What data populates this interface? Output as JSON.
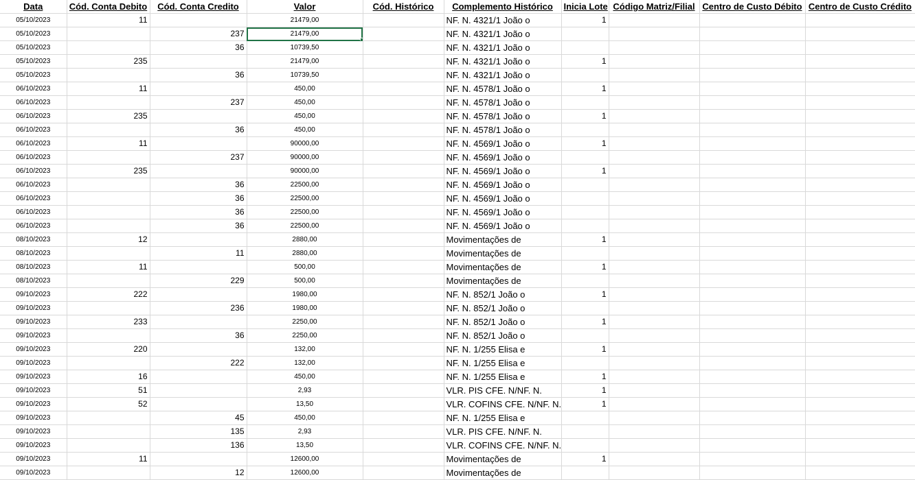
{
  "headers": [
    "Data",
    "Cód. Conta Debito",
    "Cód. Conta Credito",
    "Valor",
    "Cód. Histórico",
    "Complemento Histórico",
    "Inicia Lote",
    "Código Matriz/Filial",
    "Centro de Custo Débito",
    "Centro de Custo Crédito"
  ],
  "rows": [
    {
      "data": "05/10/2023",
      "deb": "11",
      "cred": "",
      "valor": "21479,00",
      "hist": "",
      "comp": "NF. N. 4321/1 João o",
      "lote": "1"
    },
    {
      "data": "05/10/2023",
      "deb": "",
      "cred": "237",
      "valor": "21479,00",
      "hist": "",
      "comp": "NF. N. 4321/1 João o",
      "lote": ""
    },
    {
      "data": "05/10/2023",
      "deb": "",
      "cred": "36",
      "valor": "10739,50",
      "hist": "",
      "comp": "NF. N. 4321/1 João o",
      "lote": ""
    },
    {
      "data": "05/10/2023",
      "deb": "235",
      "cred": "",
      "valor": "21479,00",
      "hist": "",
      "comp": "NF. N. 4321/1 João o",
      "lote": "1"
    },
    {
      "data": "05/10/2023",
      "deb": "",
      "cred": "36",
      "valor": "10739,50",
      "hist": "",
      "comp": "NF. N. 4321/1 João o",
      "lote": ""
    },
    {
      "data": "06/10/2023",
      "deb": "11",
      "cred": "",
      "valor": "450,00",
      "hist": "",
      "comp": "NF. N. 4578/1 João o",
      "lote": "1"
    },
    {
      "data": "06/10/2023",
      "deb": "",
      "cred": "237",
      "valor": "450,00",
      "hist": "",
      "comp": "NF. N. 4578/1 João o",
      "lote": ""
    },
    {
      "data": "06/10/2023",
      "deb": "235",
      "cred": "",
      "valor": "450,00",
      "hist": "",
      "comp": "NF. N. 4578/1 João o",
      "lote": "1"
    },
    {
      "data": "06/10/2023",
      "deb": "",
      "cred": "36",
      "valor": "450,00",
      "hist": "",
      "comp": "NF. N. 4578/1 João o",
      "lote": ""
    },
    {
      "data": "06/10/2023",
      "deb": "11",
      "cred": "",
      "valor": "90000,00",
      "hist": "",
      "comp": "NF. N. 4569/1 João o",
      "lote": "1"
    },
    {
      "data": "06/10/2023",
      "deb": "",
      "cred": "237",
      "valor": "90000,00",
      "hist": "",
      "comp": "NF. N. 4569/1 João o",
      "lote": ""
    },
    {
      "data": "06/10/2023",
      "deb": "235",
      "cred": "",
      "valor": "90000,00",
      "hist": "",
      "comp": "NF. N. 4569/1 João o",
      "lote": "1"
    },
    {
      "data": "06/10/2023",
      "deb": "",
      "cred": "36",
      "valor": "22500,00",
      "hist": "",
      "comp": "NF. N. 4569/1 João o",
      "lote": ""
    },
    {
      "data": "06/10/2023",
      "deb": "",
      "cred": "36",
      "valor": "22500,00",
      "hist": "",
      "comp": "NF. N. 4569/1 João o",
      "lote": ""
    },
    {
      "data": "06/10/2023",
      "deb": "",
      "cred": "36",
      "valor": "22500,00",
      "hist": "",
      "comp": "NF. N. 4569/1 João o",
      "lote": ""
    },
    {
      "data": "06/10/2023",
      "deb": "",
      "cred": "36",
      "valor": "22500,00",
      "hist": "",
      "comp": "NF. N. 4569/1 João o",
      "lote": ""
    },
    {
      "data": "08/10/2023",
      "deb": "12",
      "cred": "",
      "valor": "2880,00",
      "hist": "",
      "comp": "Movimentações de",
      "lote": "1"
    },
    {
      "data": "08/10/2023",
      "deb": "",
      "cred": "11",
      "valor": "2880,00",
      "hist": "",
      "comp": "Movimentações de",
      "lote": ""
    },
    {
      "data": "08/10/2023",
      "deb": "11",
      "cred": "",
      "valor": "500,00",
      "hist": "",
      "comp": "Movimentações de",
      "lote": "1"
    },
    {
      "data": "08/10/2023",
      "deb": "",
      "cred": "229",
      "valor": "500,00",
      "hist": "",
      "comp": "Movimentações de",
      "lote": ""
    },
    {
      "data": "09/10/2023",
      "deb": "222",
      "cred": "",
      "valor": "1980,00",
      "hist": "",
      "comp": "NF. N. 852/1 João o",
      "lote": "1"
    },
    {
      "data": "09/10/2023",
      "deb": "",
      "cred": "236",
      "valor": "1980,00",
      "hist": "",
      "comp": "NF. N. 852/1 João o",
      "lote": ""
    },
    {
      "data": "09/10/2023",
      "deb": "233",
      "cred": "",
      "valor": "2250,00",
      "hist": "",
      "comp": "NF. N. 852/1 João o",
      "lote": "1"
    },
    {
      "data": "09/10/2023",
      "deb": "",
      "cred": "36",
      "valor": "2250,00",
      "hist": "",
      "comp": "NF. N. 852/1 João o",
      "lote": ""
    },
    {
      "data": "09/10/2023",
      "deb": "220",
      "cred": "",
      "valor": "132,00",
      "hist": "",
      "comp": "NF. N. 1/255 Elisa e",
      "lote": "1"
    },
    {
      "data": "09/10/2023",
      "deb": "",
      "cred": "222",
      "valor": "132,00",
      "hist": "",
      "comp": "NF. N. 1/255 Elisa e",
      "lote": ""
    },
    {
      "data": "09/10/2023",
      "deb": "16",
      "cred": "",
      "valor": "450,00",
      "hist": "",
      "comp": "NF. N. 1/255 Elisa e",
      "lote": "1"
    },
    {
      "data": "09/10/2023",
      "deb": "51",
      "cred": "",
      "valor": "2,93",
      "hist": "",
      "comp": "VLR. PIS CFE. N/NF. N.",
      "lote": "1"
    },
    {
      "data": "09/10/2023",
      "deb": "52",
      "cred": "",
      "valor": "13,50",
      "hist": "",
      "comp": "VLR. COFINS CFE. N/NF. N.",
      "lote": "1"
    },
    {
      "data": "09/10/2023",
      "deb": "",
      "cred": "45",
      "valor": "450,00",
      "hist": "",
      "comp": "NF. N. 1/255 Elisa e",
      "lote": ""
    },
    {
      "data": "09/10/2023",
      "deb": "",
      "cred": "135",
      "valor": "2,93",
      "hist": "",
      "comp": "VLR. PIS CFE. N/NF. N.",
      "lote": ""
    },
    {
      "data": "09/10/2023",
      "deb": "",
      "cred": "136",
      "valor": "13,50",
      "hist": "",
      "comp": "VLR. COFINS CFE. N/NF. N.",
      "lote": ""
    },
    {
      "data": "09/10/2023",
      "deb": "11",
      "cred": "",
      "valor": "12600,00",
      "hist": "",
      "comp": "Movimentações de",
      "lote": "1"
    },
    {
      "data": "09/10/2023",
      "deb": "",
      "cred": "12",
      "valor": "12600,00",
      "hist": "",
      "comp": "Movimentações de",
      "lote": ""
    }
  ],
  "selected_cell": {
    "row": 1,
    "column": "valor"
  },
  "colors": {
    "gridline": "#d9d9d9",
    "selection": "#217346"
  }
}
